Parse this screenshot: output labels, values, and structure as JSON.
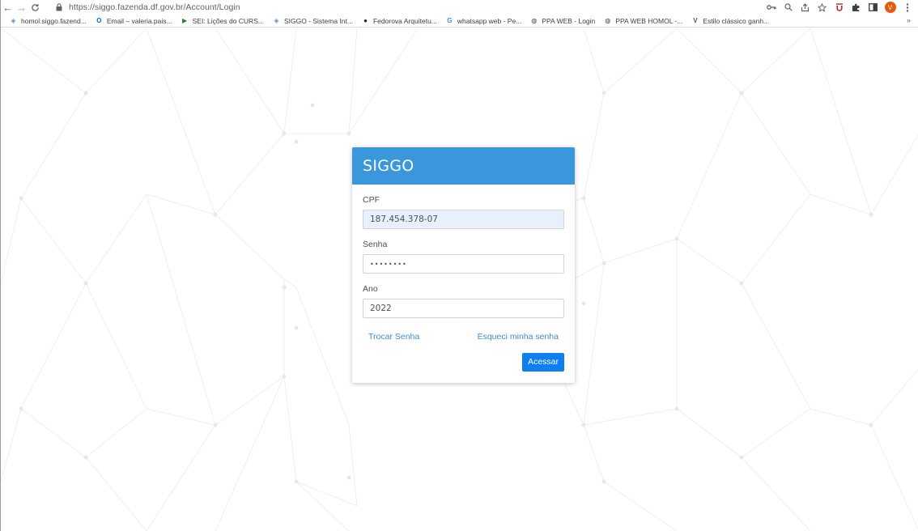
{
  "browser": {
    "url_host": "https://siggo.fazenda.df.gov.br",
    "url_path": "/Account/Login",
    "avatar_letter": "V",
    "bookmarks": [
      {
        "label": "homol.siggo.fazend...",
        "icon": "siggo-icon",
        "color": "#5a8fd6"
      },
      {
        "label": "Email – valeria.pais...",
        "icon": "outlook-icon",
        "color": "#0a64c8"
      },
      {
        "label": "SEI: Lições do CURS...",
        "icon": "sei-icon",
        "color": "#2e7d32"
      },
      {
        "label": "SIGGO - Sistema Int...",
        "icon": "siggo-icon",
        "color": "#5a8fd6"
      },
      {
        "label": "Fedorova Arquitetu...",
        "icon": "fedorova-icon",
        "color": "#222222"
      },
      {
        "label": "whatsapp web - Pe...",
        "icon": "google-icon",
        "color": "#4285f4"
      },
      {
        "label": "PPA WEB - Login",
        "icon": "globe-icon",
        "color": "#444444"
      },
      {
        "label": "PPA WEB HOMOL -...",
        "icon": "globe-icon",
        "color": "#444444"
      },
      {
        "label": "Estilo clássico ganh...",
        "icon": "vogue-icon",
        "color": "#555555"
      }
    ],
    "bookmarks_more": "»"
  },
  "login": {
    "title": "SIGGO",
    "cpf_label": "CPF",
    "cpf_value": "187.454.378-07",
    "senha_label": "Senha",
    "senha_value": "••••••••",
    "ano_label": "Ano",
    "ano_value": "2022",
    "trocar_senha": "Trocar Senha",
    "esqueci_senha": "Esqueci minha senha",
    "acessar": "Acessar"
  },
  "colors": {
    "header": "#3a97db",
    "button": "#0d7ff0",
    "link": "#3a8ddb",
    "autofill": "#e8f0fe"
  }
}
